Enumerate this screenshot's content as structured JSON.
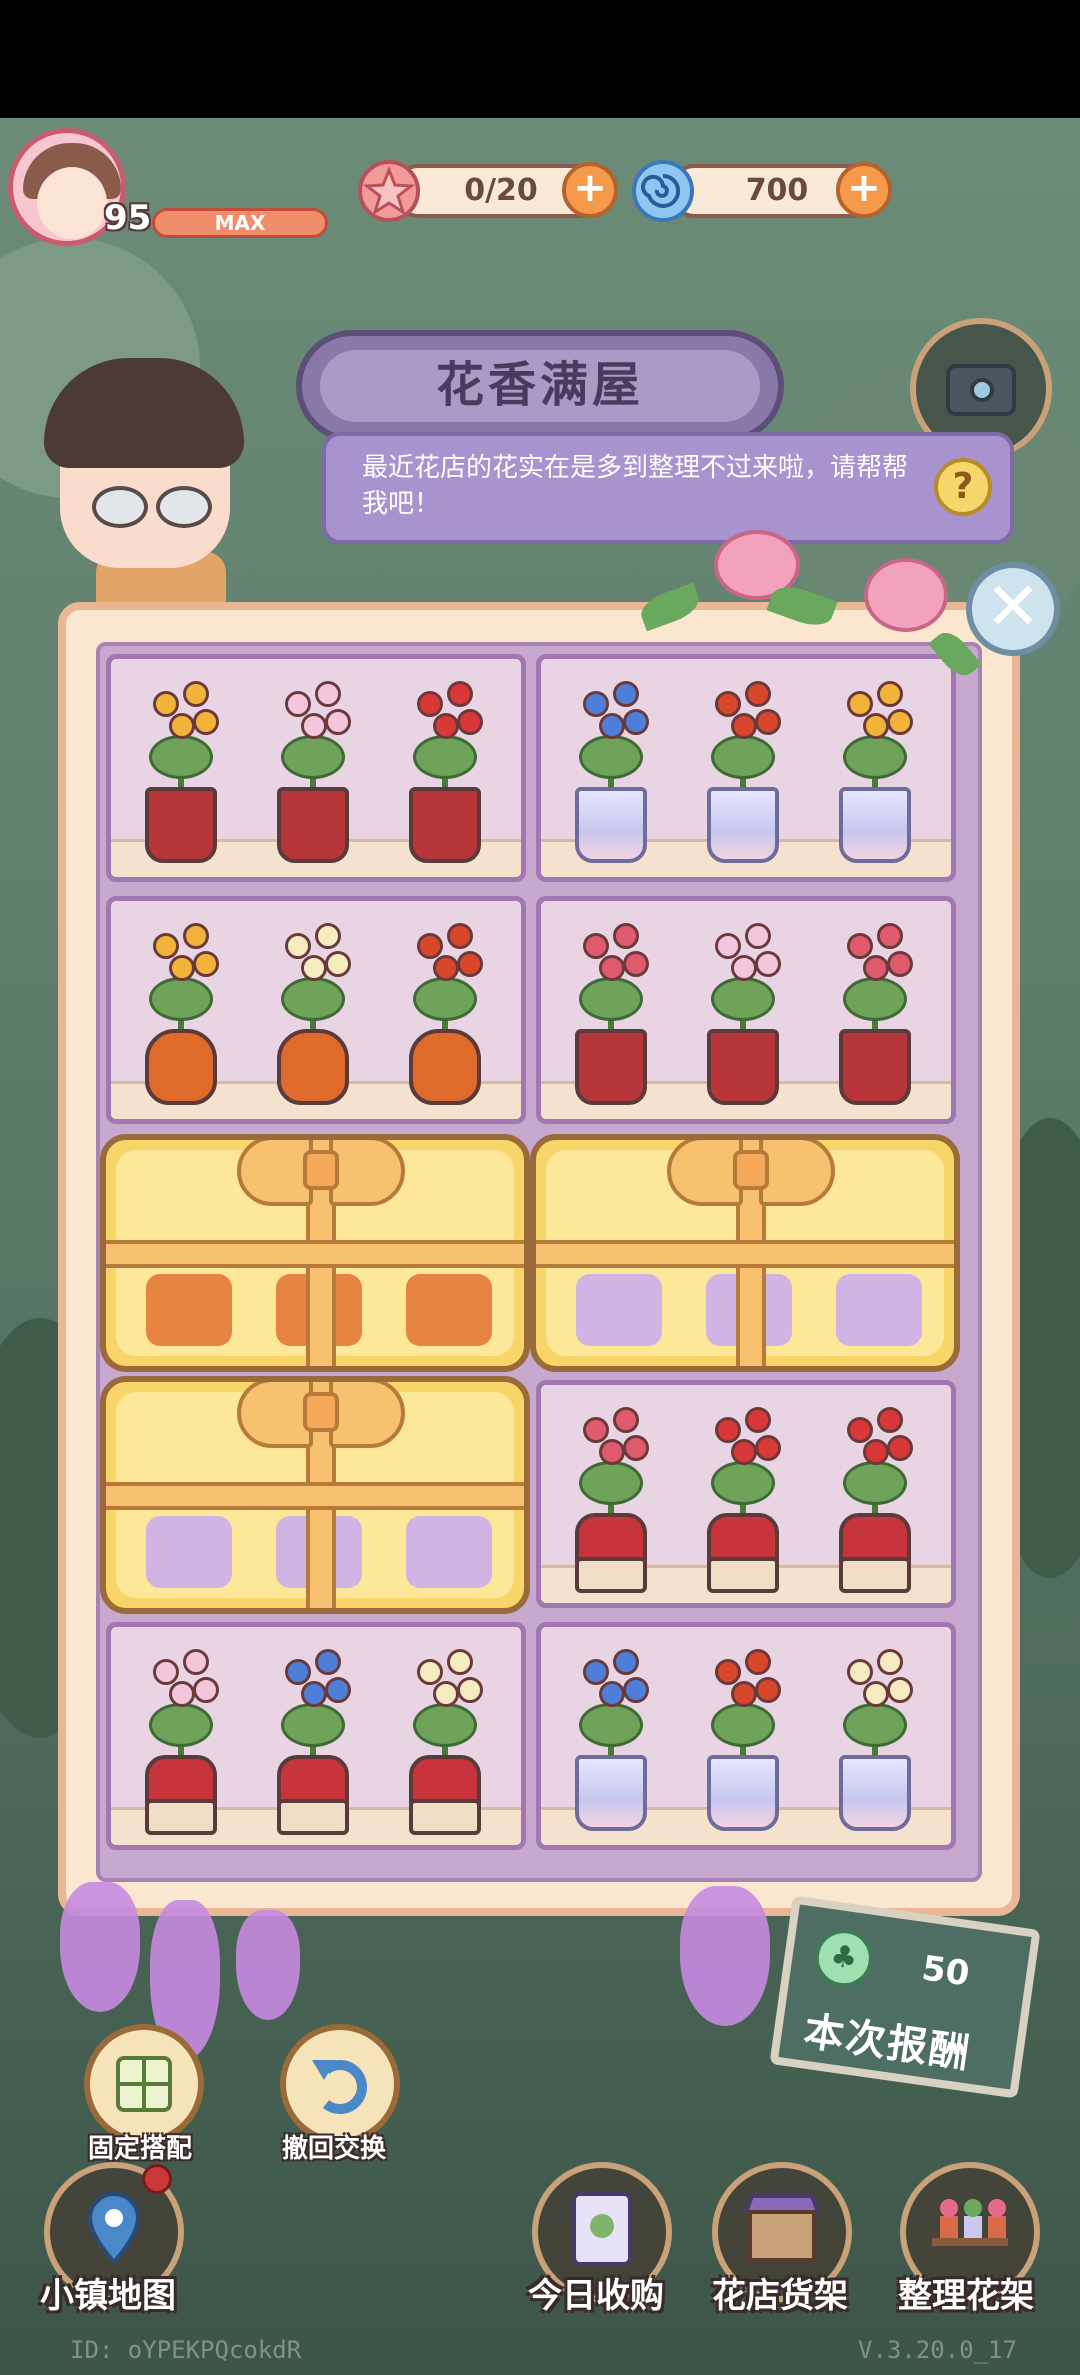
{
  "player": {
    "level": "95",
    "level_status": "MAX"
  },
  "resources": {
    "flowers": "0/20",
    "swirl": "700"
  },
  "title": "花香满屋",
  "speech": {
    "text": "最近花店的花实在是多到整理不过来啦，请帮帮我吧！",
    "help_glyph": "?"
  },
  "close_glyph": "✕",
  "shelves": [
    {
      "label": "shelf-1",
      "flowers": [
        "osmanthus",
        "orchid-pink",
        "red-kalanchoe"
      ],
      "pot": "red"
    },
    {
      "label": "shelf-2",
      "flowers": [
        "forget-me-not",
        "bird-of-paradise",
        "osmanthus"
      ],
      "pot": "glass"
    },
    {
      "label": "shelf-3",
      "flowers": [
        "osmanthus",
        "lily",
        "bird-of-paradise"
      ],
      "pot": "orange"
    },
    {
      "label": "shelf-4",
      "flowers": [
        "orchid-red",
        "orchid-pink",
        "orchid-red"
      ],
      "pot": "red"
    },
    {
      "label": "gift-5",
      "gift": true,
      "pot": "orange"
    },
    {
      "label": "gift-6",
      "gift": true,
      "pot": "glass"
    },
    {
      "label": "gift-7",
      "gift": true,
      "pot": "glass"
    },
    {
      "label": "shelf-8",
      "flowers": [
        "orchid-red",
        "red-kalanchoe",
        "red-kalanchoe"
      ],
      "pot": "dotted"
    },
    {
      "label": "shelf-9",
      "flowers": [
        "orchid-pink",
        "forget-me-not",
        "lily"
      ],
      "pot": "dotted"
    },
    {
      "label": "shelf-10",
      "flowers": [
        "forget-me-not",
        "bird-of-paradise",
        "lily"
      ],
      "pot": "glass"
    }
  ],
  "actions": {
    "fixed_match": "固定搭配",
    "undo_swap": "撤回交换"
  },
  "reward": {
    "amount": "50",
    "label": "本次报酬"
  },
  "nav": {
    "town_map": "小镇地图",
    "today_purchase": "今日收购",
    "shop_shelf": "花店货架",
    "arrange_shelf": "整理花架"
  },
  "footer": {
    "id": "ID: oYPEKPQcokdR",
    "version": "V.3.20.0_17"
  },
  "colors": {
    "bloom": {
      "osmanthus": "#f2b33a",
      "orchid-pink": "#f3c6dd",
      "red-kalanchoe": "#d83838",
      "forget-me-not": "#4e7fd8",
      "bird-of-paradise": "#d8462c",
      "lily": "#f4ecc0",
      "orchid-red": "#e05a6e"
    }
  }
}
